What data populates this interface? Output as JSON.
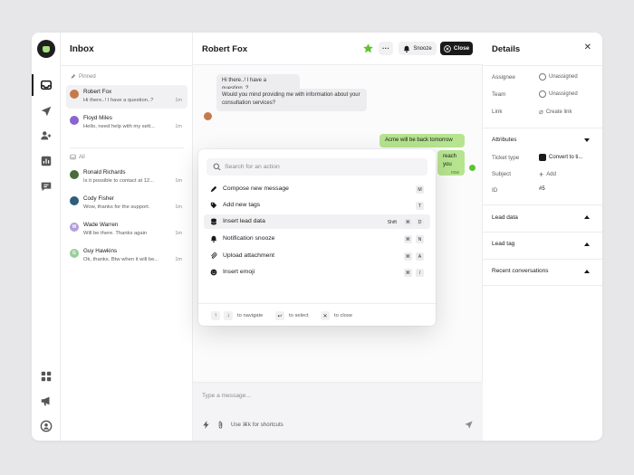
{
  "inbox": {
    "title": "Inbox",
    "pinned_label": "Pinned",
    "all_label": "All",
    "pinned": [
      {
        "name": "Robert Fox",
        "preview": "Hi there..! I have a question..?",
        "time": "1m",
        "initial": "",
        "color": "#c57a4a"
      },
      {
        "name": "Floyd Miles",
        "preview": "Hello, need help with my sett...",
        "time": "1m",
        "initial": "",
        "color": "#8a63d2"
      }
    ],
    "all": [
      {
        "name": "Ronald Richards",
        "preview": "Is it possible to contact at 12...",
        "time": "1m",
        "initial": "",
        "color": "#4b6b3c"
      },
      {
        "name": "Cody Fisher",
        "preview": "Wow, thanks for the support.",
        "time": "1m",
        "initial": "",
        "color": "#2f5d7c"
      },
      {
        "name": "Wade Warren",
        "preview": "Will be there. Thanks again",
        "time": "1m",
        "initial": "W",
        "color": "#b39ddb"
      },
      {
        "name": "Guy Hawkins",
        "preview": "Ok, thanks. Btw when it will be...",
        "time": "1m",
        "initial": "G",
        "color": "#9ccc9c"
      }
    ]
  },
  "chat": {
    "title": "Robert Fox",
    "snooze_label": "Snooze",
    "close_label": "Close",
    "messages": {
      "in1": "Hi there..! I have a question..?",
      "in2": "Would you mind providing me with information about your consultation services?",
      "out1": "Acme will be back tomorrow",
      "out2_fragment": "reach you",
      "out2_time": "now"
    },
    "composer_placeholder": "Type a message...",
    "composer_hint": "Use ⌘k for shortcuts"
  },
  "palette": {
    "search_placeholder": "Search for an action",
    "items": [
      {
        "label": "Compose new message",
        "keys": [
          "M"
        ]
      },
      {
        "label": "Add new tags",
        "keys": [
          "T"
        ]
      },
      {
        "label": "Insert lead data",
        "keys": [
          "Shift",
          "⌘",
          "D"
        ]
      },
      {
        "label": "Notification snooze",
        "keys": [
          "⌘",
          "N"
        ]
      },
      {
        "label": "Upload attachment",
        "keys": [
          "⌘",
          "A"
        ]
      },
      {
        "label": "Insert emoji",
        "keys": [
          "⌘",
          "/"
        ]
      }
    ],
    "footer": {
      "navigate": "to navigate",
      "select": "to select",
      "close": "to close"
    }
  },
  "details": {
    "title": "Details",
    "assignee_label": "Assignee",
    "assignee_value": "Unassigned",
    "team_label": "Team",
    "team_value": "Unassigned",
    "link_label": "Link",
    "link_value": "Create link",
    "attributes_label": "Attributes",
    "ticket_type_label": "Ticket type",
    "ticket_type_value": "Convert to ti...",
    "subject_label": "Subject",
    "subject_value": "Add",
    "id_label": "ID",
    "id_value": "#5",
    "lead_data_label": "Lead data",
    "lead_tag_label": "Lead tag",
    "recent_label": "Recent conversations"
  },
  "colors": {
    "accent_green": "#b6e48f",
    "dark": "#1a1a1a",
    "star": "#5fc234"
  }
}
